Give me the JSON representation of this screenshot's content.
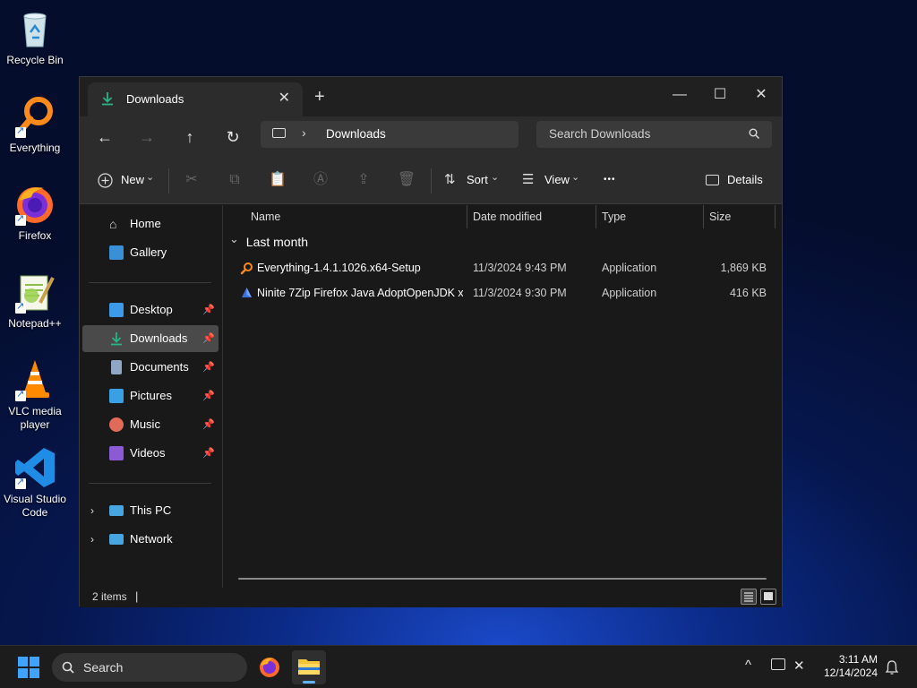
{
  "desktop": {
    "icons": [
      {
        "label": "Recycle Bin"
      },
      {
        "label": "Everything"
      },
      {
        "label": "Firefox"
      },
      {
        "label": "Notepad++"
      },
      {
        "label": "VLC media player"
      },
      {
        "label": "Visual Studio Code"
      }
    ]
  },
  "window": {
    "tab": {
      "title": "Downloads",
      "close": "✕"
    },
    "new_tab": "+",
    "controls": {
      "minimize": "—",
      "maximize": "☐",
      "close": "✕"
    },
    "nav": {
      "back": "←",
      "forward": "→",
      "up": "↑",
      "refresh": "↻"
    },
    "address": {
      "chevron": "›",
      "crumb": "Downloads"
    },
    "search": {
      "placeholder": "Search Downloads"
    },
    "toolbar": {
      "new_label": "New",
      "sort_label": "Sort",
      "view_label": "View",
      "more_label": "•••",
      "details_label": "Details",
      "dropdown_arrow": "⌄"
    },
    "sidebar": {
      "home": "Home",
      "gallery": "Gallery",
      "quick": [
        {
          "label": "Desktop",
          "color": "#3d9ae8"
        },
        {
          "label": "Downloads",
          "color": "#29b386"
        },
        {
          "label": "Documents",
          "color": "#8fa7c4"
        },
        {
          "label": "Pictures",
          "color": "#3aa0e6"
        },
        {
          "label": "Music",
          "color": "#e06b58"
        },
        {
          "label": "Videos",
          "color": "#8b5bd6"
        }
      ],
      "pin": "📌",
      "this_pc": "This PC",
      "network": "Network",
      "expander": "›"
    },
    "columns": {
      "name": "Name",
      "date": "Date modified",
      "type": "Type",
      "size": "Size"
    },
    "group": {
      "label": "Last month",
      "chevron": "⌄"
    },
    "files": [
      {
        "name": "Everything-1.4.1.1026.x64-Setup",
        "date": "11/3/2024 9:43 PM",
        "type": "Application",
        "size": "1,869 KB"
      },
      {
        "name": "Ninite 7Zip Firefox Java AdoptOpenJDK x...",
        "date": "11/3/2024 9:30 PM",
        "type": "Application",
        "size": "416 KB"
      }
    ],
    "status": {
      "count": "2 items",
      "caret": "|"
    }
  },
  "taskbar": {
    "search_label": "Search",
    "tray_chevron": "^",
    "time": "3:11 AM",
    "date": "12/14/2024"
  },
  "colors": {
    "accent": "#3ea4ff",
    "selection": "#4a4a4a",
    "window_bg": "#191919",
    "chrome_bg": "#2c2c2c"
  }
}
